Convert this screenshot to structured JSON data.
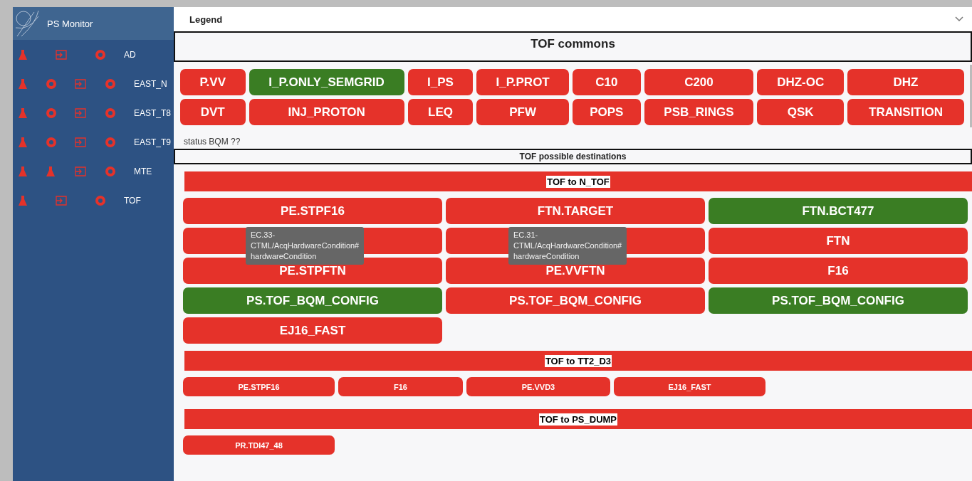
{
  "sidebar": {
    "title": "PS Monitor",
    "items": [
      {
        "label": "AD",
        "icons": [
          {
            "kind": "flask"
          },
          {
            "kind": "exit"
          },
          {
            "kind": "ring"
          }
        ]
      },
      {
        "label": "EAST_N",
        "icons": [
          {
            "kind": "flask"
          },
          {
            "kind": "ring"
          },
          {
            "kind": "exit"
          },
          {
            "kind": "ring"
          }
        ]
      },
      {
        "label": "EAST_T8",
        "icons": [
          {
            "kind": "flask"
          },
          {
            "kind": "ring"
          },
          {
            "kind": "exit"
          },
          {
            "kind": "ring"
          }
        ]
      },
      {
        "label": "EAST_T9",
        "icons": [
          {
            "kind": "flask"
          },
          {
            "kind": "ring"
          },
          {
            "kind": "exit"
          },
          {
            "kind": "ring"
          }
        ]
      },
      {
        "label": "MTE",
        "icons": [
          {
            "kind": "flask"
          },
          {
            "kind": "flask"
          },
          {
            "kind": "exit"
          },
          {
            "kind": "ring"
          }
        ]
      },
      {
        "label": "TOF",
        "icons": [
          {
            "kind": "flask"
          },
          {
            "kind": "exit"
          },
          {
            "kind": "ring"
          }
        ]
      }
    ]
  },
  "legend": {
    "title": "Legend",
    "expanded": false
  },
  "commons": {
    "title": "TOF commons",
    "buttons": [
      {
        "label": "P.VV",
        "ok": false
      },
      {
        "label": "I_P.ONLY_SEMGRID",
        "ok": true
      },
      {
        "label": "I_PS",
        "ok": false
      },
      {
        "label": "I_P.PROT",
        "ok": false
      },
      {
        "label": "C10",
        "ok": false
      },
      {
        "label": "C200",
        "ok": false
      },
      {
        "label": "DHZ-OC",
        "ok": false
      },
      {
        "label": "DHZ",
        "ok": false
      },
      {
        "label": "DVT",
        "ok": false
      },
      {
        "label": "INJ_PROTON",
        "ok": false
      },
      {
        "label": "LEQ",
        "ok": false
      },
      {
        "label": "PFW",
        "ok": false
      },
      {
        "label": "POPS",
        "ok": false
      },
      {
        "label": "PSB_RINGS",
        "ok": false
      },
      {
        "label": "QSK",
        "ok": false
      },
      {
        "label": "TRANSITION",
        "ok": false
      }
    ]
  },
  "status_text": "status BQM ??",
  "destinations": {
    "title": "TOF possible destinations",
    "sections": [
      {
        "title": "TOF to N_TOF",
        "kind": "large",
        "buttons": [
          {
            "label": "PE.STPF16",
            "ok": false
          },
          {
            "label": "FTN.TARGET",
            "ok": false
          },
          {
            "label": "FTN.BCT477",
            "ok": true
          },
          {
            "ok": false,
            "tooltip": [
              "EC.33-",
              "CTML/AcqHardwareCondition#",
              "hardwareCondition"
            ]
          },
          {
            "ok": false,
            "tooltip": [
              "EC.31-",
              "CTML/AcqHardwareCondition#",
              "hardwareCondition"
            ]
          },
          {
            "label": "FTN",
            "ok": false
          },
          {
            "label": "PE.STPFTN",
            "ok": false
          },
          {
            "label": "PE.VVFTN",
            "ok": false
          },
          {
            "label": "F16",
            "ok": false
          },
          {
            "label": "PS.TOF_BQM_CONFIG",
            "ok": true
          },
          {
            "label": "PS.TOF_BQM_CONFIG",
            "ok": false
          },
          {
            "label": "PS.TOF_BQM_CONFIG",
            "ok": true
          },
          {
            "label": "EJ16_FAST",
            "ok": false
          }
        ]
      },
      {
        "title": "TOF to TT2_D3",
        "kind": "small",
        "buttons": [
          {
            "label": "PE.STPF16",
            "ok": false
          },
          {
            "label": "F16",
            "ok": false
          },
          {
            "label": "PE.VVD3",
            "ok": false
          },
          {
            "label": "EJ16_FAST",
            "ok": false
          }
        ]
      },
      {
        "title": "TOF to PS_DUMP",
        "kind": "small",
        "buttons": [
          {
            "label": "PR.TDI47_48",
            "ok": false
          }
        ]
      }
    ]
  }
}
